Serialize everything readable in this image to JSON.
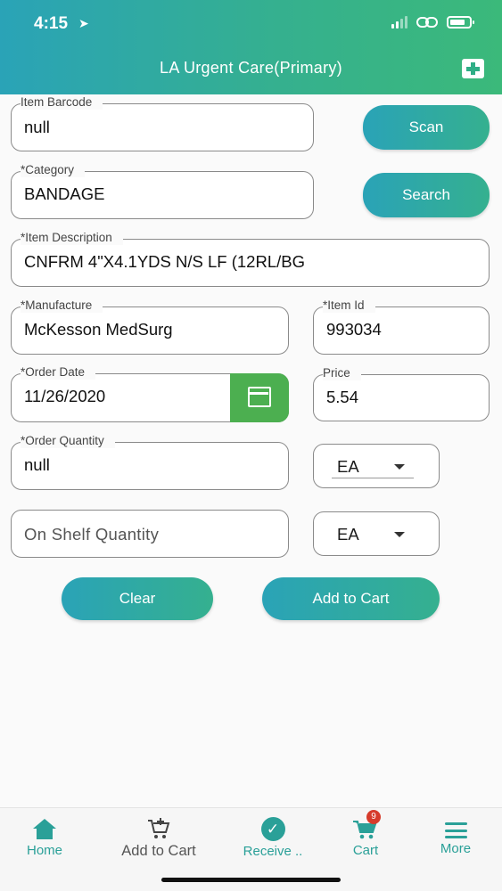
{
  "status_bar": {
    "time": "4:15"
  },
  "header": {
    "title": "LA Urgent Care(Primary)",
    "add_icon": "plus-square-icon"
  },
  "form": {
    "barcode": {
      "label": "Item Barcode",
      "value": "null"
    },
    "category": {
      "label": "*Category",
      "value": "BANDAGE"
    },
    "description": {
      "label": "*Item Description",
      "value": "CNFRM 4\"X4.1YDS N/S LF (12RL/BG"
    },
    "manufacture": {
      "label": "*Manufacture",
      "value": "McKesson MedSurg"
    },
    "item_id": {
      "label": "*Item Id",
      "value": "993034"
    },
    "order_date": {
      "label": "*Order Date",
      "value": "11/26/2020"
    },
    "price": {
      "label": "Price",
      "value": "5.54"
    },
    "order_quantity": {
      "label": "*Order Quantity",
      "value": "null",
      "unit": "EA"
    },
    "on_shelf_quantity": {
      "placeholder": "On Shelf Quantity",
      "unit": "EA"
    }
  },
  "buttons": {
    "scan": "Scan",
    "search": "Search",
    "clear": "Clear",
    "add_to_cart": "Add to Cart"
  },
  "tabbar": {
    "home": "Home",
    "add_to_cart": "Add to Cart",
    "receive": "Receive ..",
    "cart": "Cart",
    "cart_badge": "9",
    "more": "More"
  },
  "colors": {
    "accent_start": "#2aa3b7",
    "accent_end": "#3bb97a",
    "calendar_green": "#4caf50",
    "badge_red": "#d63b2b"
  }
}
